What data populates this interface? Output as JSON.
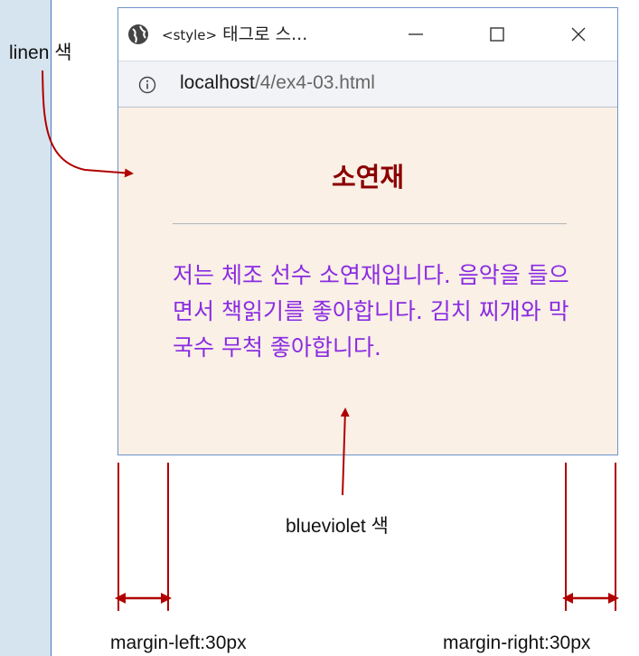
{
  "browser": {
    "tab_title": "태그로 스...",
    "tab_tag": "<style>",
    "url_host": "localhost",
    "url_path": "/4/ex4-03.html"
  },
  "page": {
    "heading": "소연재",
    "paragraph": "저는 체조 선수 소연재입니다. 음악을 들으면서 책읽기를 좋아합니다. 김치 찌개와 막국수 무척 좋아합니다.",
    "heading_color": "#8b0000",
    "text_color": "#8a2be2",
    "background_color": "#faf0e6"
  },
  "annotations": {
    "linen": "linen 색",
    "blueviolet": "blueviolet 색",
    "margin_left": "margin-left:30px",
    "margin_right": "margin-right:30px"
  },
  "colors": {
    "arrow": "#b00000",
    "sidebar": "#d6e4f0",
    "frame": "#6c94c8"
  }
}
